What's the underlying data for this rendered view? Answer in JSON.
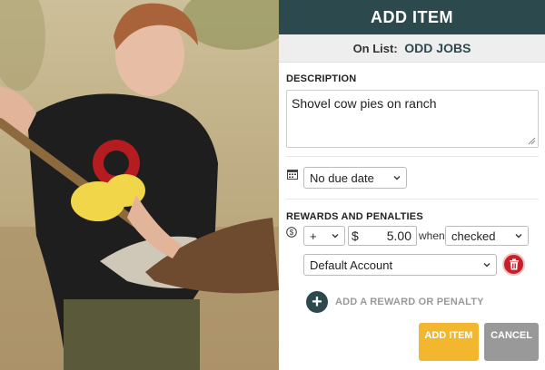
{
  "photo": {
    "subject": "boy-with-shovel-photo"
  },
  "dialog": {
    "title": "ADD ITEM",
    "on_list_label": "On List:",
    "list_name": "ODD JOBS",
    "description_label": "DESCRIPTION",
    "description_value": "Shovel cow pies on ranch",
    "due_date": {
      "selected": "No due date",
      "icon": "calendar-icon"
    },
    "rewards_label": "REWARDS AND PENALTIES",
    "reward_row": {
      "icon": "dollar-circle-icon",
      "sign": "+",
      "currency": "$",
      "amount": "5.00",
      "when_label": "when",
      "condition": "checked",
      "account": "Default Account",
      "delete_icon": "trash-icon"
    },
    "add_reward_label": "ADD A REWARD OR PENALTY",
    "add_button": "ADD ITEM",
    "cancel_button": "CANCEL"
  },
  "colors": {
    "header_bg": "#2c4a4e",
    "accent_button": "#f2b72e",
    "cancel_button": "#999999",
    "delete_button": "#c8202a"
  }
}
